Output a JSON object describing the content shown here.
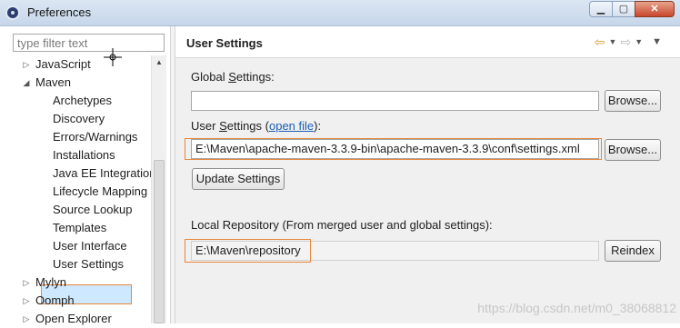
{
  "window": {
    "title": "Preferences"
  },
  "filter": {
    "placeholder": "type filter text"
  },
  "tree": {
    "items": [
      {
        "label": "JavaScript",
        "level": 1,
        "twisty": "▷"
      },
      {
        "label": "Maven",
        "level": 1,
        "twisty": "◢"
      },
      {
        "label": "Archetypes",
        "level": 2
      },
      {
        "label": "Discovery",
        "level": 2
      },
      {
        "label": "Errors/Warnings",
        "level": 2
      },
      {
        "label": "Installations",
        "level": 2
      },
      {
        "label": "Java EE Integration",
        "level": 2
      },
      {
        "label": "Lifecycle Mapping",
        "level": 2
      },
      {
        "label": "Source Lookup",
        "level": 2
      },
      {
        "label": "Templates",
        "level": 2
      },
      {
        "label": "User Interface",
        "level": 2
      },
      {
        "label": "User Settings",
        "level": 2,
        "selected": true
      },
      {
        "label": "Mylyn",
        "level": 1,
        "twisty": "▷"
      },
      {
        "label": "Oomph",
        "level": 1,
        "twisty": "▷"
      },
      {
        "label": "Open Explorer",
        "level": 1,
        "twisty": "▷"
      }
    ]
  },
  "page": {
    "title": "User Settings",
    "global_settings": {
      "label_pre": "Global ",
      "label_mn": "S",
      "label_post": "ettings:",
      "value": "",
      "browse_label": "Browse..."
    },
    "user_settings": {
      "label_pre": "User ",
      "label_mn": "S",
      "label_post": "ettings (",
      "link": "open file",
      "label_end": "):",
      "value": "E:\\Maven\\apache-maven-3.3.9-bin\\apache-maven-3.3.9\\conf\\settings.xml",
      "browse_label": "Browse...",
      "update_label": "Update Settings"
    },
    "local_repository": {
      "label": "Local Repository (From merged user and global settings):",
      "value": "E:\\Maven\\repository",
      "reindex_label": "Reindex"
    }
  },
  "watermark": "https://blog.csdn.net/m0_38068812",
  "colors": {
    "highlight_border": "#e8863a",
    "selection_bg": "#cde8ff",
    "link": "#1a5fb4"
  }
}
